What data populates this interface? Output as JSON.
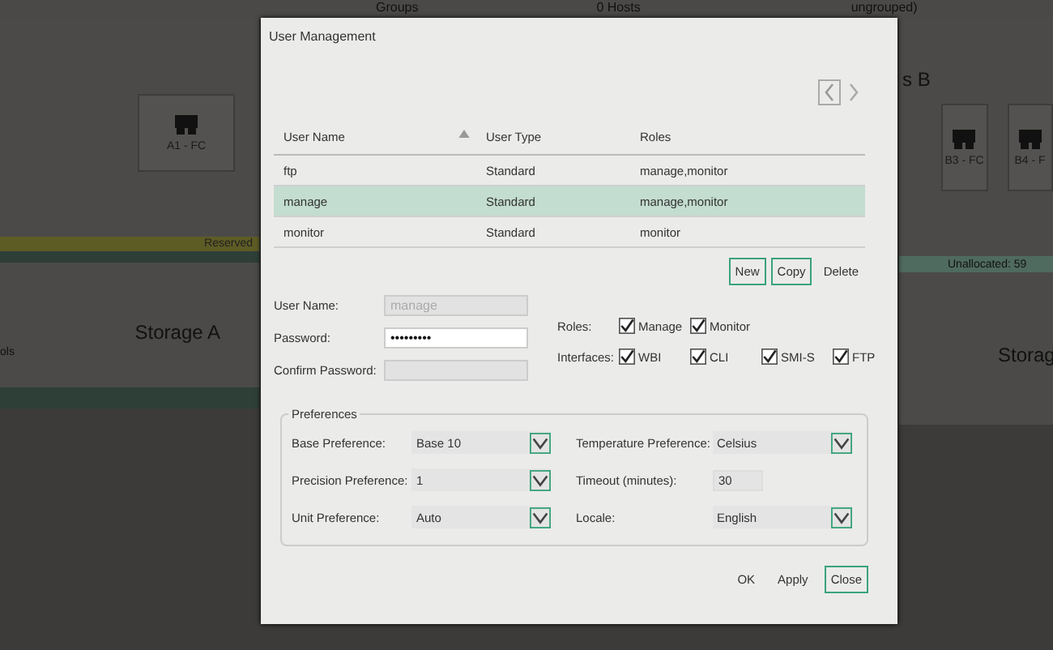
{
  "background": {
    "top_bar": [
      "Groups",
      "0 Hosts",
      "ungrouped)"
    ],
    "left": {
      "tile": "A1 - FC",
      "band": "Reserved",
      "heading": "Storage A",
      "label": "ols"
    },
    "right": {
      "heading_top": "s B",
      "tiles": [
        "B3 - FC",
        "B4 - F"
      ],
      "band": "Unallocated: 59",
      "heading": "Storag"
    }
  },
  "dialog": {
    "title": "User Management",
    "table": {
      "columns": [
        {
          "label": "User Name",
          "sorted": true
        },
        {
          "label": "User Type",
          "sorted": false
        },
        {
          "label": "Roles",
          "sorted": false
        }
      ],
      "rows": [
        {
          "cells": [
            "ftp",
            "Standard",
            "manage,monitor"
          ],
          "selected": false
        },
        {
          "cells": [
            "manage",
            "Standard",
            "manage,monitor"
          ],
          "selected": true
        },
        {
          "cells": [
            "monitor",
            "Standard",
            "monitor"
          ],
          "selected": false
        }
      ]
    },
    "table_buttons": [
      {
        "label": "New",
        "kind": "outlined"
      },
      {
        "label": "Copy",
        "kind": "outlined"
      },
      {
        "label": "Delete",
        "kind": "plain"
      }
    ],
    "fields": [
      {
        "label": "User Name:",
        "value": "manage",
        "disabled": true
      },
      {
        "label": "Password:",
        "value": "•••••••••",
        "disabled": false
      },
      {
        "label": "Confirm Password:",
        "disabled": true
      }
    ],
    "roles": {
      "label": "Roles:",
      "options": [
        {
          "label": "Manage",
          "checked": true
        },
        {
          "label": "Monitor",
          "checked": true
        }
      ]
    },
    "interfaces": {
      "label": "Interfaces:",
      "options": [
        {
          "label": "WBI",
          "checked": true
        },
        {
          "label": "CLI",
          "checked": true
        },
        {
          "label": "SMI-S",
          "checked": true
        },
        {
          "label": "FTP",
          "checked": true
        }
      ]
    },
    "preferences": {
      "title": "Preferences",
      "items": [
        {
          "label": "Base Preference:",
          "value": "Base 10",
          "kind": "dropdown"
        },
        {
          "label": "Temperature Preference:",
          "value": "Celsius",
          "kind": "dropdown"
        },
        {
          "label": "Precision Preference:",
          "value": "1",
          "kind": "dropdown"
        },
        {
          "label": "Timeout (minutes):",
          "value": "30",
          "kind": "text"
        },
        {
          "label": "Unit Preference:",
          "value": "Auto",
          "kind": "dropdown"
        },
        {
          "label": "Locale:",
          "value": "English",
          "kind": "dropdown"
        }
      ]
    },
    "footer_buttons": [
      {
        "label": "OK",
        "kind": "plain"
      },
      {
        "label": "Apply",
        "kind": "plain"
      },
      {
        "label": "Close",
        "kind": "outlined"
      }
    ]
  }
}
